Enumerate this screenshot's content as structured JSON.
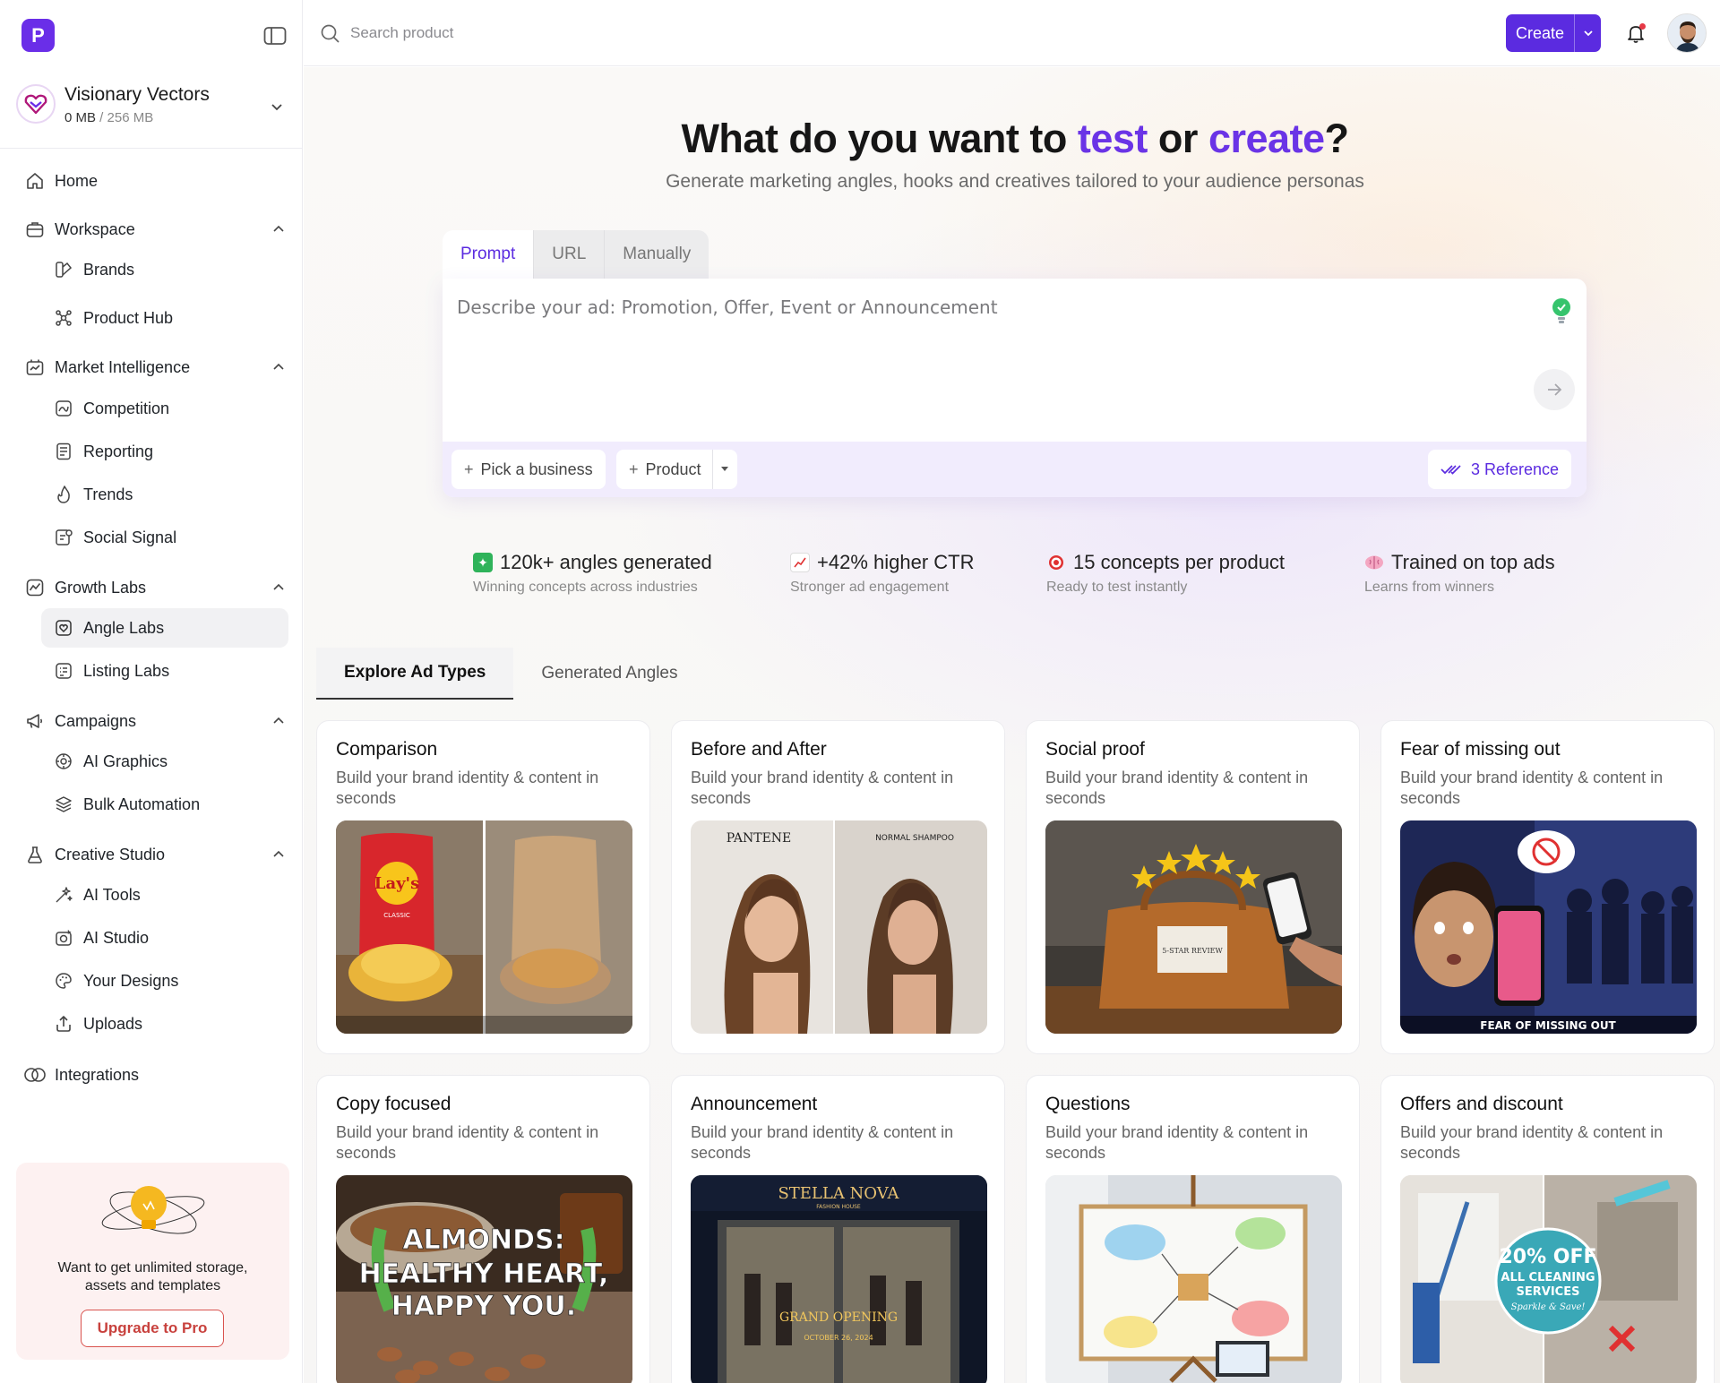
{
  "app": {
    "logo_letter": "P"
  },
  "workspace": {
    "name": "Visionary Vectors",
    "storage_used": "0 MB",
    "storage_total": "256 MB"
  },
  "sidebar": {
    "home": "Home",
    "workspace": {
      "label": "Workspace",
      "items": [
        "Brands",
        "Product Hub"
      ]
    },
    "market": {
      "label": "Market Intelligence",
      "items": [
        "Competition",
        "Reporting",
        "Trends",
        "Social Signal"
      ]
    },
    "growth": {
      "label": "Growth Labs",
      "items": [
        "Angle Labs",
        "Listing Labs"
      ]
    },
    "campaigns": {
      "label": "Campaigns",
      "items": [
        "AI Graphics",
        "Bulk Automation"
      ]
    },
    "creative": {
      "label": "Creative Studio",
      "items": [
        "AI Tools",
        "AI Studio",
        "Your Designs",
        "Uploads"
      ]
    },
    "integrations": "Integrations",
    "upgrade": {
      "text": "Want to get unlimited storage, assets and templates",
      "button": "Upgrade to Pro"
    }
  },
  "topbar": {
    "search_placeholder": "Search product",
    "create_label": "Create"
  },
  "hero": {
    "title_a": "What do you want to ",
    "title_test": "test",
    "title_b": " or ",
    "title_create": "create",
    "title_c": "?",
    "subtitle": "Generate marketing angles, hooks and creatives tailored to your audience personas"
  },
  "prompt": {
    "tabs": [
      "Prompt",
      "URL",
      "Manually"
    ],
    "placeholder": "Describe your ad: Promotion, Offer, Event or Announcement",
    "pick_business": "Pick a business",
    "product": "Product",
    "reference": "3 Reference"
  },
  "stats": [
    {
      "title": "120k+ angles generated",
      "sub": "Winning concepts across industries",
      "emoji": "sparkle"
    },
    {
      "title": "+42% higher CTR",
      "sub": "Stronger ad engagement",
      "emoji": "chart"
    },
    {
      "title": "15 concepts per product",
      "sub": "Ready to test instantly",
      "emoji": "target"
    },
    {
      "title": "Trained on top ads",
      "sub": "Learns from winners",
      "emoji": "brain"
    }
  ],
  "content_tabs": [
    "Explore Ad Types",
    "Generated Angles"
  ],
  "cards": [
    {
      "title": "Comparison",
      "desc": "Build your brand identity & content in seconds"
    },
    {
      "title": "Before and After",
      "desc": "Build your brand identity & content in seconds"
    },
    {
      "title": "Social proof",
      "desc": "Build your brand identity & content in seconds"
    },
    {
      "title": "Fear of missing out",
      "desc": "Build your brand identity & content in seconds"
    },
    {
      "title": "Copy focused",
      "desc": "Build your brand identity & content in seconds"
    },
    {
      "title": "Announcement",
      "desc": "Build your brand identity & content in seconds"
    },
    {
      "title": "Questions",
      "desc": "Build your brand identity & content in seconds"
    },
    {
      "title": "Offers and discount",
      "desc": "Build your brand identity & content in seconds"
    }
  ],
  "card_image_text": {
    "lays": "Lay's",
    "lays_classic": "CLASSIC",
    "pantene": "PANTENE",
    "normal_shampoo": "NORMAL SHAMPOO",
    "review": "5-STAR REVIEW",
    "fomo": "FEAR OF MISSING OUT",
    "almonds_1": "ALMONDS:",
    "almonds_2": "HEALTHY HEART,",
    "almonds_3": "HAPPY YOU.",
    "stella": "STELLA NOVA",
    "fashion_house": "FASHION HOUSE",
    "grand_opening": "GRAND OPENING",
    "date": "OCTOBER 26, 2024",
    "offer_1": "20% OFF",
    "offer_2": "ALL CLEANING",
    "offer_3": "SERVICES",
    "offer_4": "Sparkle & Save!"
  }
}
